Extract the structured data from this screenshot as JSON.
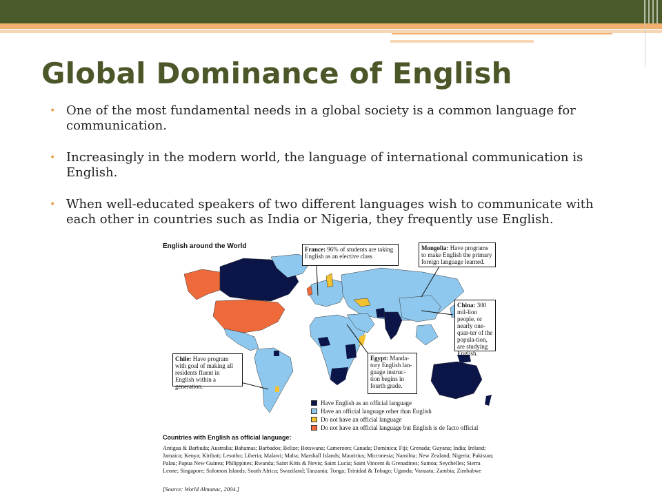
{
  "slide": {
    "title": "Global Dominance of English",
    "bullets": [
      "One of the most fundamental needs in a global society is a common language for communication.",
      "Increasingly in the modern world, the language of international communication is English.",
      "When well-educated speakers of two different languages wish to communicate with each other in countries such as India or Nigeria, they frequently use English."
    ]
  },
  "map": {
    "title": "English around the World",
    "callouts": {
      "france": {
        "head": "France:",
        "body": " 96% of students are taking English as an elective class"
      },
      "mongolia": {
        "head": "Mongolia:",
        "body": " Have programs to make English the primary foreign language learned."
      },
      "china": {
        "head": "China:",
        "body": " 300 mil-lion people, or nearly one-quar-ter of the popula-tion, are studying English."
      },
      "chile": {
        "head": "Chile:",
        "body": " Have program with goal of making all residents fluent in English within a generation."
      },
      "egypt": {
        "head": "Egypt:",
        "body": " Manda-tory English lan-guage instruc-tion begins in fourth grade."
      }
    },
    "legend": [
      {
        "label": "Have English as an official language",
        "color": "#0c1547"
      },
      {
        "label": "Have an official language other than English",
        "color": "#8ec8ee"
      },
      {
        "label": "Do not have an official language",
        "color": "#f3c230"
      },
      {
        "label": "Do not have an official language but English is de facto official",
        "color": "#ef6a3a"
      }
    ],
    "countries_heading": "Countries with English as official language:",
    "countries_text": "Antigua & Barbuda; Australia; Bahamas; Barbados; Belize; Botswana; Cameroon; Canada; Dominica; Fiji; Grenada; Guyana; India; Ireland; Jamaica; Kenya; Kiribati; Lesotho; Liberia; Malawi; Malta; Marshall Islands; Mauritius; Micronesia; Namibia; New Zealand; Nigeria; Pakistan; Palau; Papua New Guinea; Philippines; Rwanda; Saint Kitts & Nevis; Saint Lucia; Saint Vincent & Grenadines; Samoa; Seychelles; Sierra Leone; Singapore; Solomon Islands; South Africa; Swaziland; Tanzania; Tonga; Trinidad & Tobago; Uganda; Vanuatu; Zambia; Zimbabwe",
    "source": "[Source: World Almanac, 2004.]"
  },
  "colors": {
    "accent_green": "#4b5728",
    "bullet_orange": "#e8a04a",
    "official": "#0c1547",
    "other_official": "#8ec8ee",
    "no_official": "#f3c230",
    "de_facto": "#ef6a3a"
  }
}
